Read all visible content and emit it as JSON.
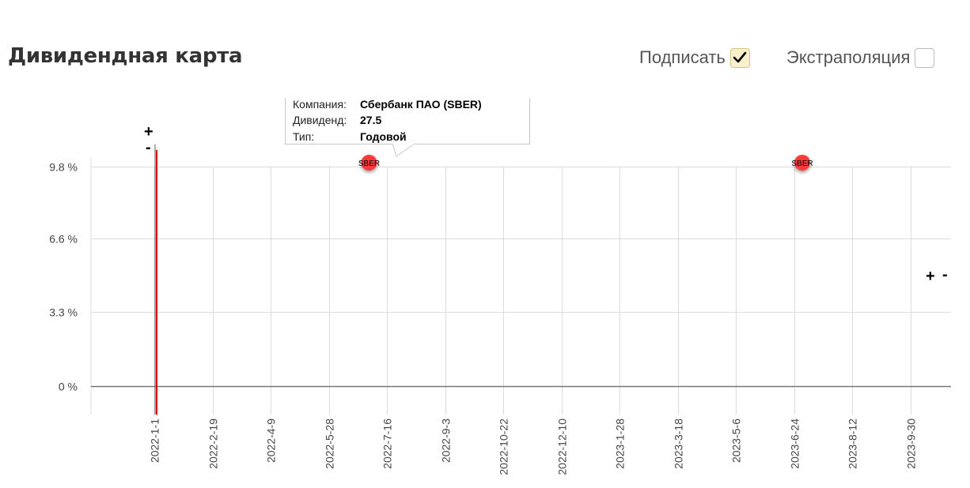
{
  "header": {
    "title": "Дивидендная карта",
    "label_option": "Подписать",
    "label_checked": true,
    "extrap_option": "Экстраполяция",
    "extrap_checked": false
  },
  "zoom": {
    "plus": "+",
    "minus": "-"
  },
  "tooltip": {
    "company_key": "Компания:",
    "company_value": "Сбербанк ПАО (SBER)",
    "dividend_key": "Дивиденд:",
    "dividend_value": "27.5",
    "type_key": "Тип:",
    "type_value": "Годовой"
  },
  "colors": {
    "grid": "#dcdcdc",
    "zero_line": "#777777",
    "today_line": "#e00000",
    "marker": "#ff3b3b"
  },
  "chart_data": {
    "type": "scatter",
    "title": "",
    "xlabel": "",
    "ylabel": "",
    "x_type": "date",
    "xlim": [
      "2021-12-08",
      "2023-11-17"
    ],
    "ylim": [
      -1.2,
      9.8
    ],
    "y_ticks": [
      {
        "value": 9.8,
        "label": "9.8 %"
      },
      {
        "value": 6.6,
        "label": "6.6 %"
      },
      {
        "value": 3.3,
        "label": "3.3 %"
      },
      {
        "value": 0,
        "label": "0 %"
      }
    ],
    "x_ticks": [
      {
        "value": "2022-01-01",
        "label": "2022-1-1"
      },
      {
        "value": "2022-02-19",
        "label": "2022-2-19"
      },
      {
        "value": "2022-04-09",
        "label": "2022-4-9"
      },
      {
        "value": "2022-05-28",
        "label": "2022-5-28"
      },
      {
        "value": "2022-07-16",
        "label": "2022-7-16"
      },
      {
        "value": "2022-09-03",
        "label": "2022-9-3"
      },
      {
        "value": "2022-10-22",
        "label": "2022-10-22"
      },
      {
        "value": "2022-12-10",
        "label": "2022-12-10"
      },
      {
        "value": "2023-01-28",
        "label": "2023-1-28"
      },
      {
        "value": "2023-03-18",
        "label": "2023-3-18"
      },
      {
        "value": "2023-05-06",
        "label": "2023-5-6"
      },
      {
        "value": "2023-06-24",
        "label": "2023-6-24"
      },
      {
        "value": "2023-08-12",
        "label": "2023-8-12"
      },
      {
        "value": "2023-09-30",
        "label": "2023-9-30"
      }
    ],
    "today_marker": "2022-01-03",
    "grid": true,
    "points": [
      {
        "x": "2022-07-01",
        "y": 9.8,
        "label": "SBER"
      },
      {
        "x": "2023-07-01",
        "y": 9.8,
        "label": "SBER"
      }
    ]
  }
}
